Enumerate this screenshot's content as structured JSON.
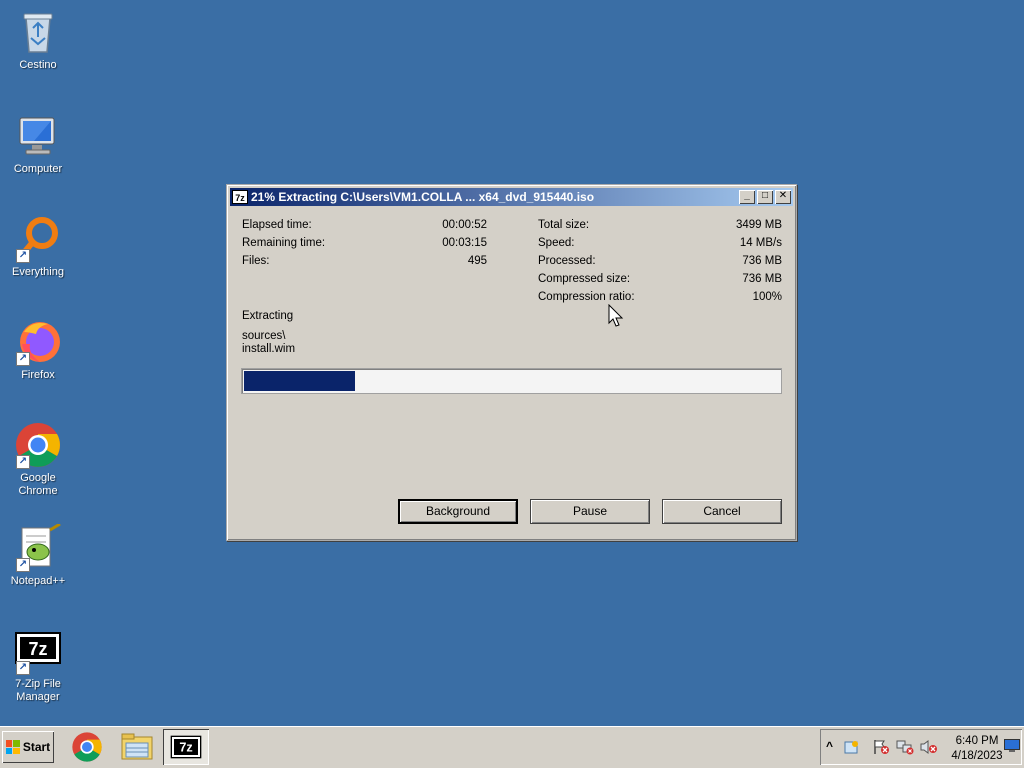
{
  "desktop": {
    "icons": [
      {
        "label": "Cestino"
      },
      {
        "label": "Computer"
      },
      {
        "label": "Everything"
      },
      {
        "label": "Firefox"
      },
      {
        "label": "Google Chrome"
      },
      {
        "label": "Notepad++"
      },
      {
        "label": "7-Zip File Manager"
      }
    ]
  },
  "dialog": {
    "title": "21% Extracting C:\\Users\\VM1.COLLA ... x64_dvd_915440.iso",
    "app_icon": "7z",
    "stats_left": [
      {
        "label": "Elapsed time:",
        "value": "00:00:52"
      },
      {
        "label": "Remaining time:",
        "value": "00:03:15"
      },
      {
        "label": "Files:",
        "value": "495"
      }
    ],
    "stats_right": [
      {
        "label": "Total size:",
        "value": "3499 MB"
      },
      {
        "label": "Speed:",
        "value": "14 MB/s"
      },
      {
        "label": "Processed:",
        "value": "736 MB"
      },
      {
        "label": "Compressed size:",
        "value": "736 MB"
      },
      {
        "label": "Compression ratio:",
        "value": "100%"
      }
    ],
    "status": "Extracting",
    "current_path": "sources\\",
    "current_file": "install.wim",
    "progress_percent": 21,
    "buttons": {
      "background": "Background",
      "pause": "Pause",
      "cancel": "Cancel"
    },
    "progress_color": "#0a246a"
  },
  "taskbar": {
    "start_label": "Start",
    "apps": [
      "chrome-icon",
      "file-explorer-icon",
      "7zip-icon"
    ],
    "active_app": "7zip-icon",
    "tray_expand": "^",
    "clock_time": "6:40 PM",
    "clock_date": "4/18/2023"
  },
  "colors": {
    "desktop_bg": "#3a6ea5",
    "titlebar_start": "#0a246a",
    "titlebar_end": "#a6caf0"
  }
}
